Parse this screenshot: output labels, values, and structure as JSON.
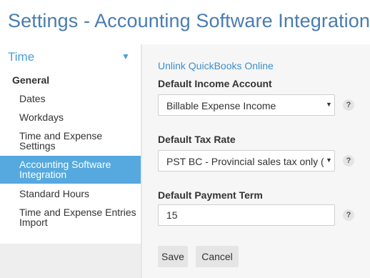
{
  "page": {
    "title": "Settings - Accounting Software Integration"
  },
  "sidebar": {
    "section_label": "Time",
    "caret_icon": "triangle-down-icon",
    "group_label": "General",
    "items": [
      {
        "label": "Dates"
      },
      {
        "label": "Workdays"
      },
      {
        "line1": "Time and Expense",
        "line2": "Settings"
      },
      {
        "line1": "Accounting Software",
        "line2": "Integration",
        "active": true
      },
      {
        "label": "Standard Hours"
      },
      {
        "line1": "Time and Expense Entries",
        "line2": "Import"
      }
    ]
  },
  "main": {
    "unlink_label": "Unlink QuickBooks Online",
    "income_account": {
      "label": "Default Income Account",
      "value": "Billable Expense Income"
    },
    "tax_rate": {
      "label": "Default Tax Rate",
      "value": "PST BC - Provincial sales tax only (B"
    },
    "payment_term": {
      "label": "Default Payment Term",
      "value": "15"
    },
    "help_glyph": "?",
    "save_label": "Save",
    "cancel_label": "Cancel"
  },
  "colors": {
    "title": "#4a7cb0",
    "accent": "#4a9fd8",
    "active_item_bg": "#55a9de",
    "link": "#3c8fcd",
    "main_bg": "#f6f6f6"
  }
}
